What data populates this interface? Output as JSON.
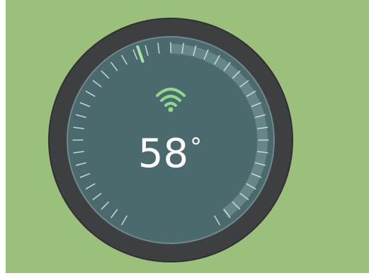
{
  "thermostat": {
    "temperature": "58",
    "unit_symbol": "°",
    "setpoint_tick_color": "#a6e3a1",
    "status_icon": "wifi-icon",
    "status_icon_color": "#8fd98a"
  },
  "colors": {
    "background": "#9bc07c",
    "outer_ring": "#3e3f41",
    "dial_face": "#4a6a6e",
    "tick": "#dbe3e3",
    "arc_highlight": "#7d9c9c"
  }
}
